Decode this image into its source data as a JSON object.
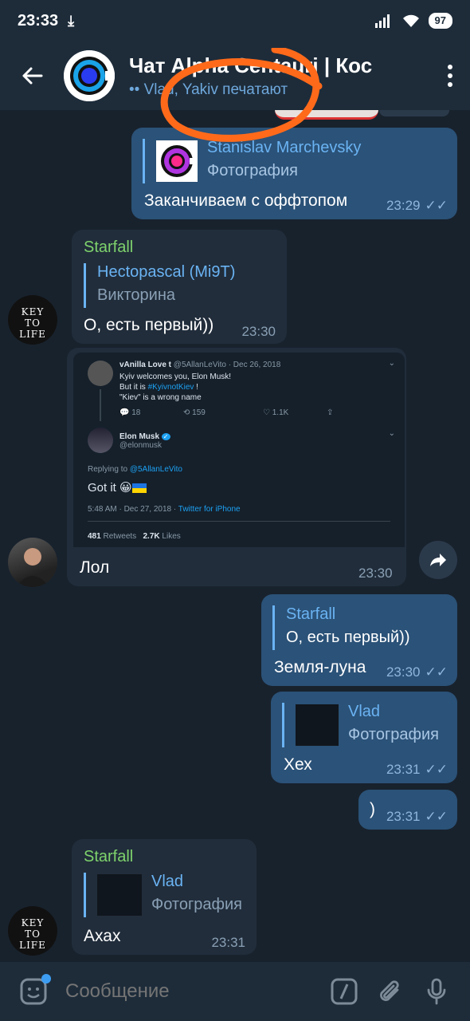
{
  "statusbar": {
    "time": "23:33",
    "battery": "97"
  },
  "header": {
    "title": "Чат Alpha Centauri | Кос",
    "status": "Vlad, Yakiv печатают"
  },
  "messages": {
    "m1": {
      "reply_name": "Stanislav Marchevsky",
      "reply_sub": "Фотография",
      "text": "Заканчиваем с оффтопом",
      "time": "23:29"
    },
    "m2": {
      "sender": "Starfall",
      "reply_name": "Hectopascal (Mi9T)",
      "reply_sub": "Викторина",
      "text": "О, есть первый))",
      "time": "23:30"
    },
    "m3": {
      "text": "Лол",
      "time": "23:30"
    },
    "m4": {
      "reply_name": "Starfall",
      "reply_sub": "О, есть первый))",
      "text": "Земля-луна",
      "time": "23:30"
    },
    "m5": {
      "reply_name": "Vlad",
      "reply_sub": "Фотография",
      "text": "Хех",
      "time": "23:31"
    },
    "m6": {
      "text": ")",
      "time": "23:31"
    },
    "m7": {
      "sender": "Starfall",
      "reply_name": "Vlad",
      "reply_sub": "Фотография",
      "text": "Ахах",
      "time": "23:31"
    }
  },
  "avatars": {
    "key_to_life": "KEY TO LIFE"
  },
  "tweet": {
    "t1_name": "vAnilla Love t",
    "t1_handle": "@5AllanLeVito · Dec 26, 2018",
    "t1_line1": "Kyiv welcomes you, Elon Musk!",
    "t1_line2_a": "But it is ",
    "t1_line2_link": "#KyivnotKiev",
    "t1_line2_b": " !",
    "t1_line3": "\"Kiev\" is a wrong name",
    "t1_replies": "18",
    "t1_retweets": "159",
    "t1_likes": "1.1K",
    "t2_name": "Elon Musk",
    "t2_handle": "@elonmusk",
    "t2_replying_prefix": "Replying to ",
    "t2_replying_handle": "@5AllanLeVito",
    "t2_text": "Got it",
    "t2_date": "5:48 AM · Dec 27, 2018 · ",
    "t2_source": "Twitter for iPhone",
    "t2_retweets_count": "481",
    "t2_retweets_label": "Retweets",
    "t2_likes_count": "2.7K",
    "t2_likes_label": "Likes"
  },
  "composer": {
    "placeholder": "Сообщение"
  },
  "colors": {
    "outgoing": "#2b5278",
    "incoming": "#212d3b",
    "accent": "#6ab3f3",
    "sender": "#7ed36c",
    "annotation": "#ff6a1a"
  }
}
